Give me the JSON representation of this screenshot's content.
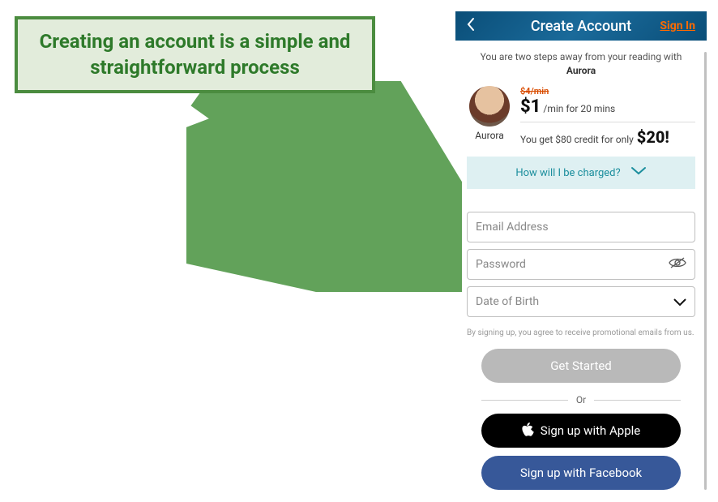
{
  "callout": {
    "text": "Creating an account is a simple and straightforward process"
  },
  "titlebar": {
    "title": "Create Account",
    "sign_in": "Sign In"
  },
  "lead": {
    "prefix": "You are two steps away from your reading with ",
    "name": "Aurora"
  },
  "advisor": {
    "name": "Aurora",
    "old_price": "$4/min",
    "new_price": "$1",
    "price_suffix": "/min for 20 mins",
    "credit_text": "You get $80 credit for only",
    "credit_amount": "$20!"
  },
  "infobar": {
    "label": "How will I be charged?"
  },
  "form": {
    "email_placeholder": "Email Address",
    "password_placeholder": "Password",
    "dob_placeholder": "Date of Birth",
    "disclaimer": "By signing up, you agree to receive promotional emails from us."
  },
  "buttons": {
    "get_started": "Get Started",
    "or": "Or",
    "apple": "Sign up with Apple",
    "facebook": "Sign up with Facebook"
  }
}
